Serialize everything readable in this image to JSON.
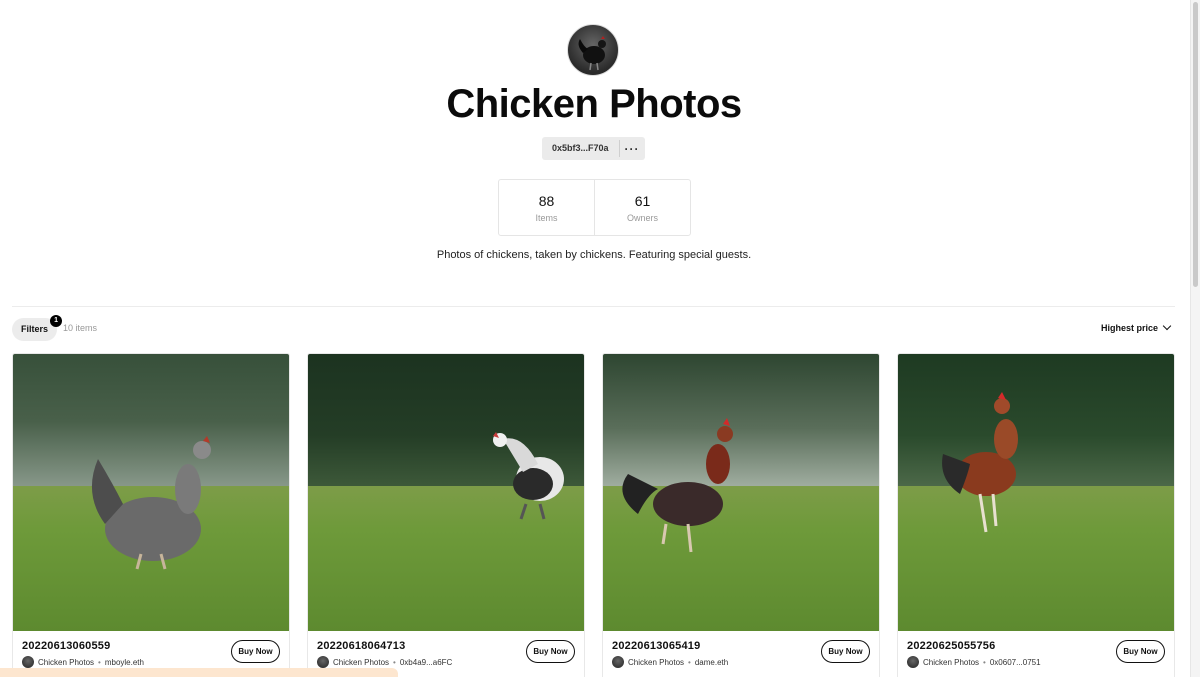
{
  "collection": {
    "title": "Chicken Photos",
    "address": "0x5bf3...F70a",
    "more_label": "···",
    "description": "Photos of chickens, taken by chickens. Featuring special guests."
  },
  "stats": [
    {
      "value": "88",
      "label": "Items"
    },
    {
      "value": "61",
      "label": "Owners"
    }
  ],
  "toolbar": {
    "filters_label": "Filters",
    "filters_badge": "1",
    "item_count": "10 items",
    "sort_label": "Highest price"
  },
  "cards": [
    {
      "name": "20220613060559",
      "collection": "Chicken Photos",
      "owner": "mboyle.eth",
      "buy_label": "Buy Now"
    },
    {
      "name": "20220618064713",
      "collection": "Chicken Photos",
      "owner": "0xb4a9...a6FC",
      "buy_label": "Buy Now"
    },
    {
      "name": "20220613065419",
      "collection": "Chicken Photos",
      "owner": "dame.eth",
      "buy_label": "Buy Now"
    },
    {
      "name": "20220625055756",
      "collection": "Chicken Photos",
      "owner": "0x0607...0751",
      "buy_label": "Buy Now"
    }
  ],
  "colors": {
    "grass": "#6e9a3a",
    "trees_dark": "#1e3320",
    "accent": "#000000"
  }
}
